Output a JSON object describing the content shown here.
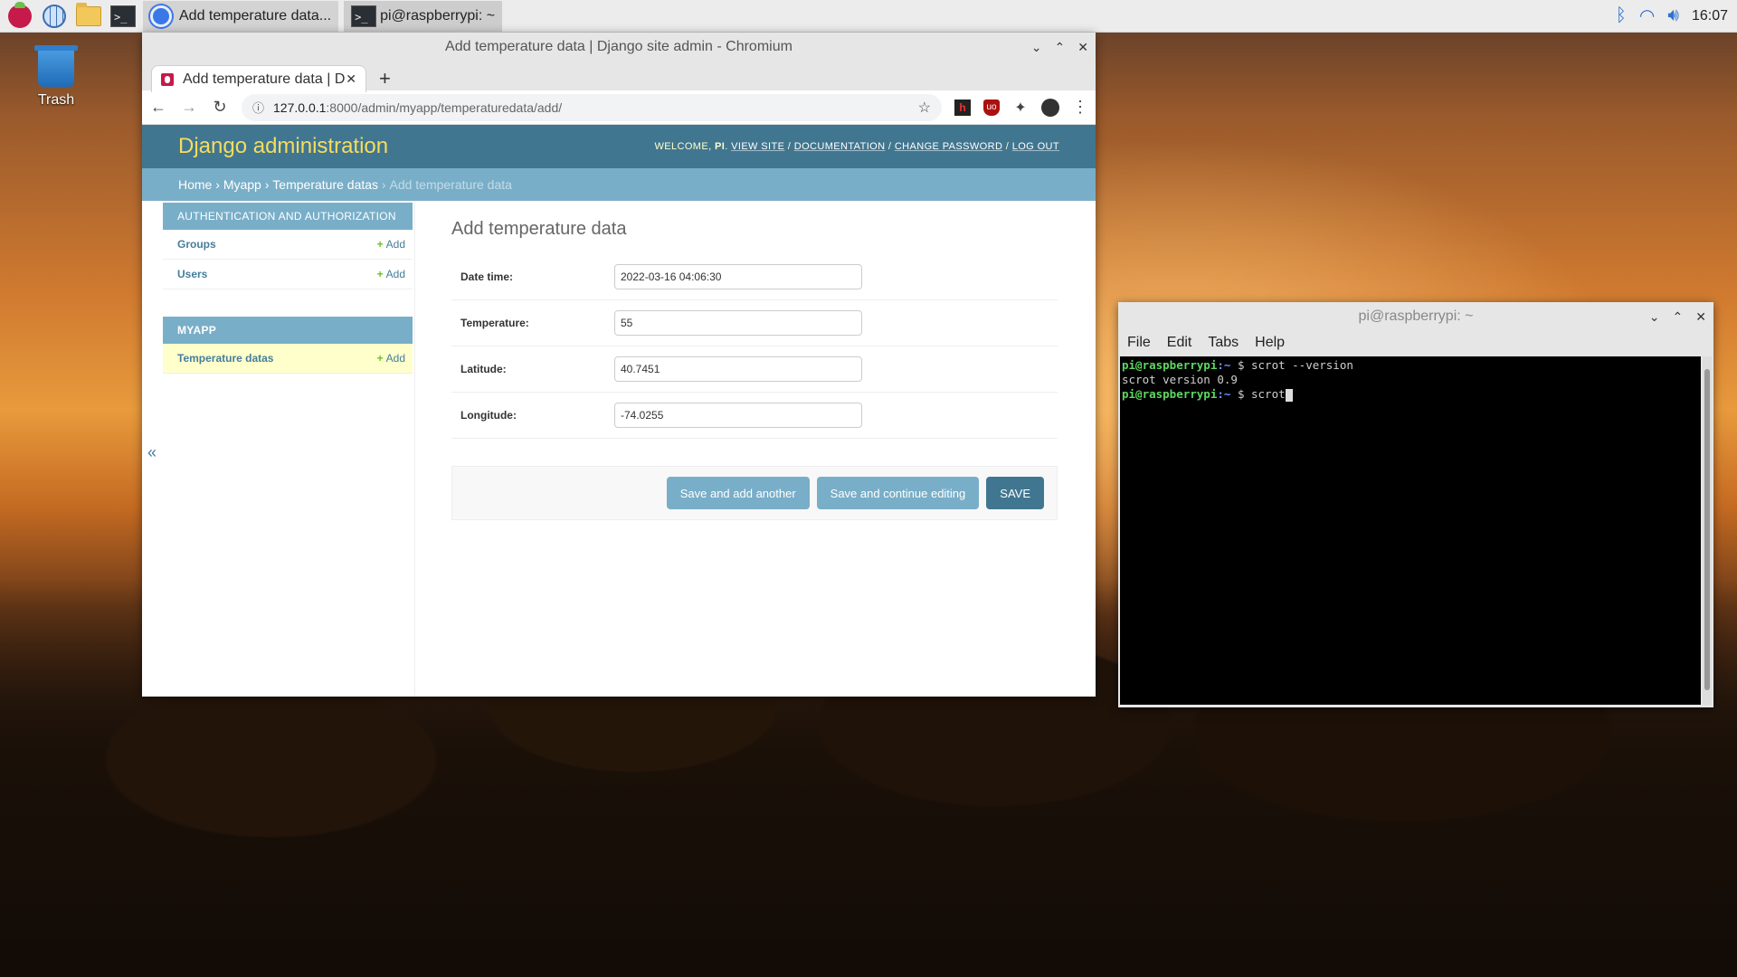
{
  "taskbar": {
    "tasks": [
      {
        "label": "Add temperature data..."
      },
      {
        "label": "pi@raspberrypi: ~"
      }
    ],
    "clock": "16:07"
  },
  "desktop": {
    "trash_label": "Trash"
  },
  "browser": {
    "window_title": "Add temperature data | Django site admin - Chromium",
    "tab_title": "Add temperature data | D",
    "url_host": "127.0.0.1",
    "url_path": ":8000/admin/myapp/temperaturedata/add/"
  },
  "admin": {
    "brand": "Django administration",
    "user_tools": {
      "welcome": "WELCOME,",
      "user": "PI",
      "view_site": "VIEW SITE",
      "documentation": "DOCUMENTATION",
      "change_password": "CHANGE PASSWORD",
      "log_out": "LOG OUT"
    },
    "breadcrumbs": {
      "home": "Home",
      "app": "Myapp",
      "model": "Temperature datas",
      "current": "Add temperature data"
    },
    "sidebar": {
      "apps": [
        {
          "caption": "AUTHENTICATION AND AUTHORIZATION",
          "models": [
            {
              "name": "Groups",
              "add": "Add"
            },
            {
              "name": "Users",
              "add": "Add"
            }
          ]
        },
        {
          "caption": "MYAPP",
          "models": [
            {
              "name": "Temperature datas",
              "add": "Add"
            }
          ]
        }
      ],
      "toggle": "«"
    },
    "form": {
      "title": "Add temperature data",
      "fields": [
        {
          "label": "Date time:",
          "value": "2022-03-16 04:06:30"
        },
        {
          "label": "Temperature:",
          "value": "55"
        },
        {
          "label": "Latitude:",
          "value": "40.7451"
        },
        {
          "label": "Longitude:",
          "value": "-74.0255"
        }
      ],
      "buttons": {
        "save_add_another": "Save and add another",
        "save_continue": "Save and continue editing",
        "save": "SAVE"
      }
    }
  },
  "terminal": {
    "title": "pi@raspberrypi: ~",
    "menu": [
      "File",
      "Edit",
      "Tabs",
      "Help"
    ],
    "lines": [
      {
        "user": "pi@raspberrypi",
        "path": ":~",
        "prompt": " $ ",
        "cmd": "scrot --version"
      },
      {
        "output": "scrot version 0.9"
      },
      {
        "user": "pi@raspberrypi",
        "path": ":~",
        "prompt": " $ ",
        "cmd": "scrot"
      }
    ]
  },
  "colors": {
    "django_header": "#417690",
    "django_brand": "#f5dd5d",
    "django_crumbs": "#79aec8",
    "terminal_user": "#5fd75f",
    "terminal_path": "#6f8fff"
  }
}
